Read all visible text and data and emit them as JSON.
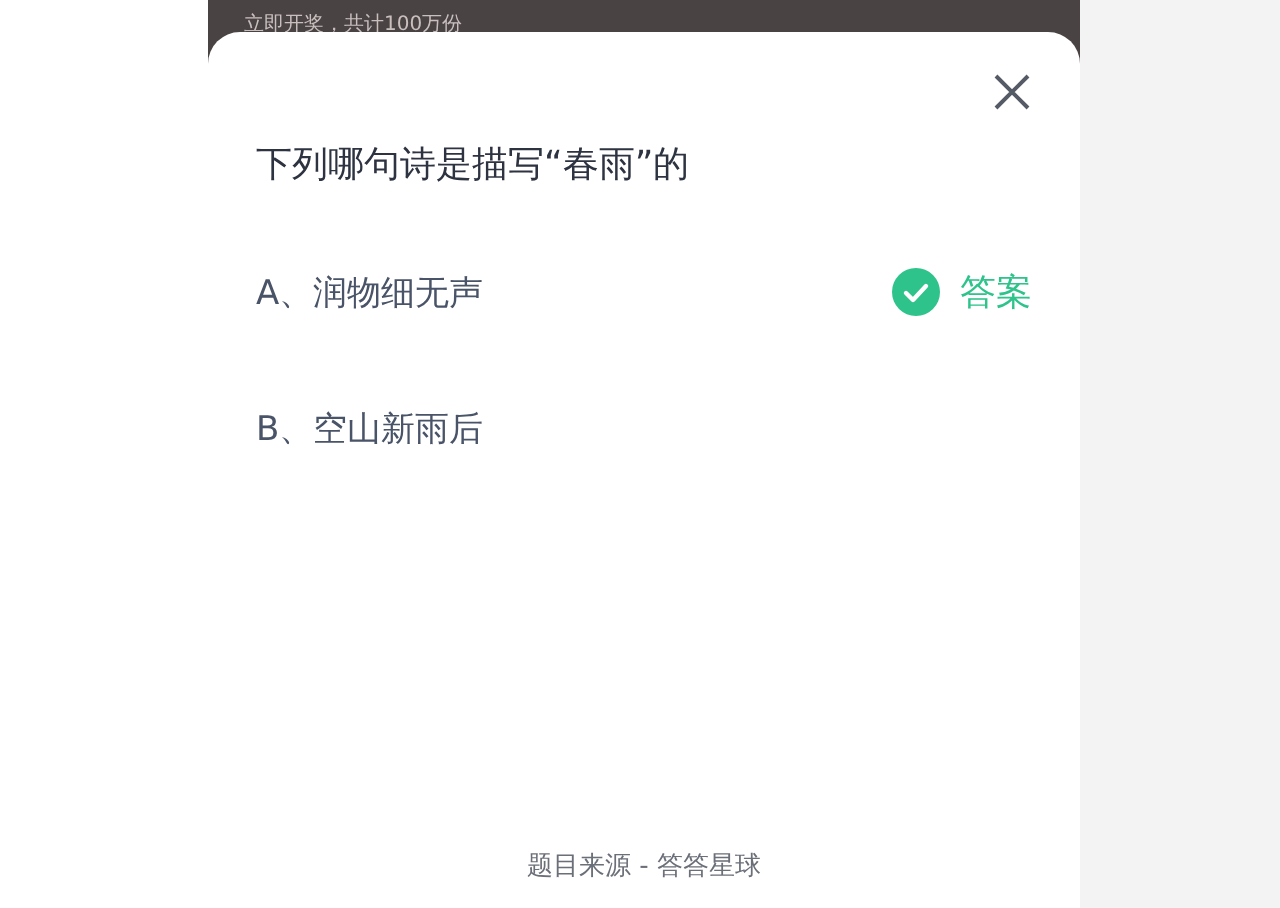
{
  "background_banner": {
    "text": "立即开奖，共计100万份"
  },
  "question": {
    "title": "下列哪句诗是描写“春雨”的"
  },
  "options": [
    {
      "label": "A、润物细无声",
      "correct": true,
      "answer_label": "答案"
    },
    {
      "label": "B、空山新雨后",
      "correct": false
    }
  ],
  "footer": {
    "source": "题目来源 - 答答星球"
  }
}
